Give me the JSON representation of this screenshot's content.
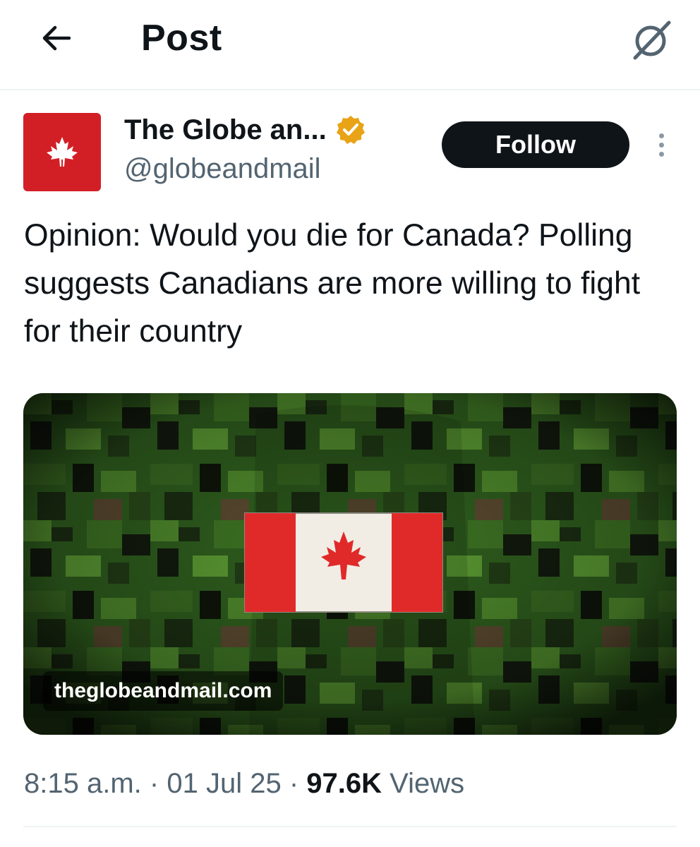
{
  "header": {
    "title": "Post",
    "back_icon": "arrow-left-icon",
    "grok_icon": "grok-icon"
  },
  "author": {
    "display_name": "The Globe an...",
    "handle": "@globeandmail",
    "verified_icon": "verified-badge-icon",
    "verified_color": "#e8a317",
    "avatar_icon": "maple-leaf-icon",
    "avatar_color": "#d21f26"
  },
  "actions": {
    "follow_label": "Follow",
    "more_icon": "more-vertical-icon"
  },
  "tweet": {
    "text": "Opinion: Would you die for Canada? Polling suggests Canadians are more willing to fight for their country"
  },
  "card": {
    "domain": "theglobeandmail.com",
    "image": "camouflage-uniform-with-canadian-flag-patch"
  },
  "meta": {
    "time": "8:15 a.m.",
    "separator": "·",
    "date": "01 Jul 25",
    "views_count": "97.6K",
    "views_label": "Views"
  }
}
